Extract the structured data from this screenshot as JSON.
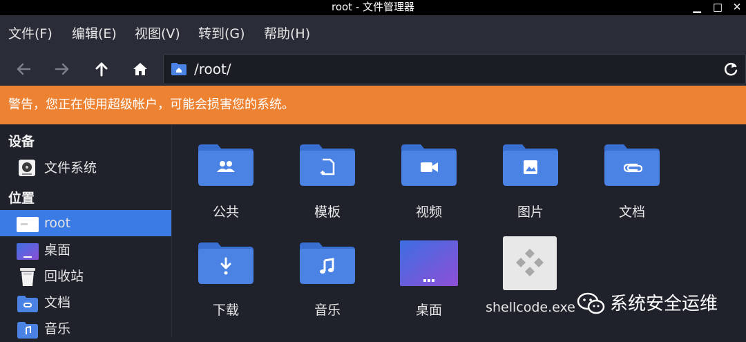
{
  "window": {
    "title": "root - 文件管理器",
    "minimize_glyph": "▁",
    "maximize_glyph": "□",
    "close_glyph": "✕"
  },
  "menubar": {
    "items": [
      {
        "label": "文件(F)"
      },
      {
        "label": "编辑(E)"
      },
      {
        "label": "视图(V)"
      },
      {
        "label": "转到(G)"
      },
      {
        "label": "帮助(H)"
      }
    ]
  },
  "toolbar": {
    "path": "/root/",
    "icons": [
      "back-icon",
      "forward-icon",
      "up-icon",
      "home-icon",
      "reload-icon"
    ]
  },
  "warning": {
    "text": "警告，您正在使用超级帐户，可能会损害您的系统。"
  },
  "sidebar": {
    "devices_heading": "设备",
    "places_heading": "位置",
    "devices": [
      {
        "label": "文件系统",
        "icon": "drive-icon"
      }
    ],
    "places": [
      {
        "label": "root",
        "icon": "home-folder-icon",
        "selected": true
      },
      {
        "label": "桌面",
        "icon": "desktop-icon"
      },
      {
        "label": "回收站",
        "icon": "trash-icon"
      },
      {
        "label": "文档",
        "icon": "documents-folder-icon"
      },
      {
        "label": "音乐",
        "icon": "music-folder-icon"
      }
    ]
  },
  "files": [
    {
      "label": "公共",
      "icon": "public-folder-icon"
    },
    {
      "label": "模板",
      "icon": "templates-folder-icon"
    },
    {
      "label": "视频",
      "icon": "videos-folder-icon"
    },
    {
      "label": "图片",
      "icon": "pictures-folder-icon"
    },
    {
      "label": "文档",
      "icon": "documents-folder-icon"
    },
    {
      "label": "下载",
      "icon": "downloads-folder-icon"
    },
    {
      "label": "音乐",
      "icon": "music-folder-icon"
    },
    {
      "label": "桌面",
      "icon": "desktop-folder-icon"
    },
    {
      "label": "shellcode.exe",
      "icon": "exe-file-icon"
    }
  ],
  "watermark": {
    "text": "系统安全运维"
  },
  "colors": {
    "folder": "#4b83e4",
    "folder_tab": "#3a6fd2",
    "warning": "#ec8232",
    "selected": "#3a7be5"
  }
}
